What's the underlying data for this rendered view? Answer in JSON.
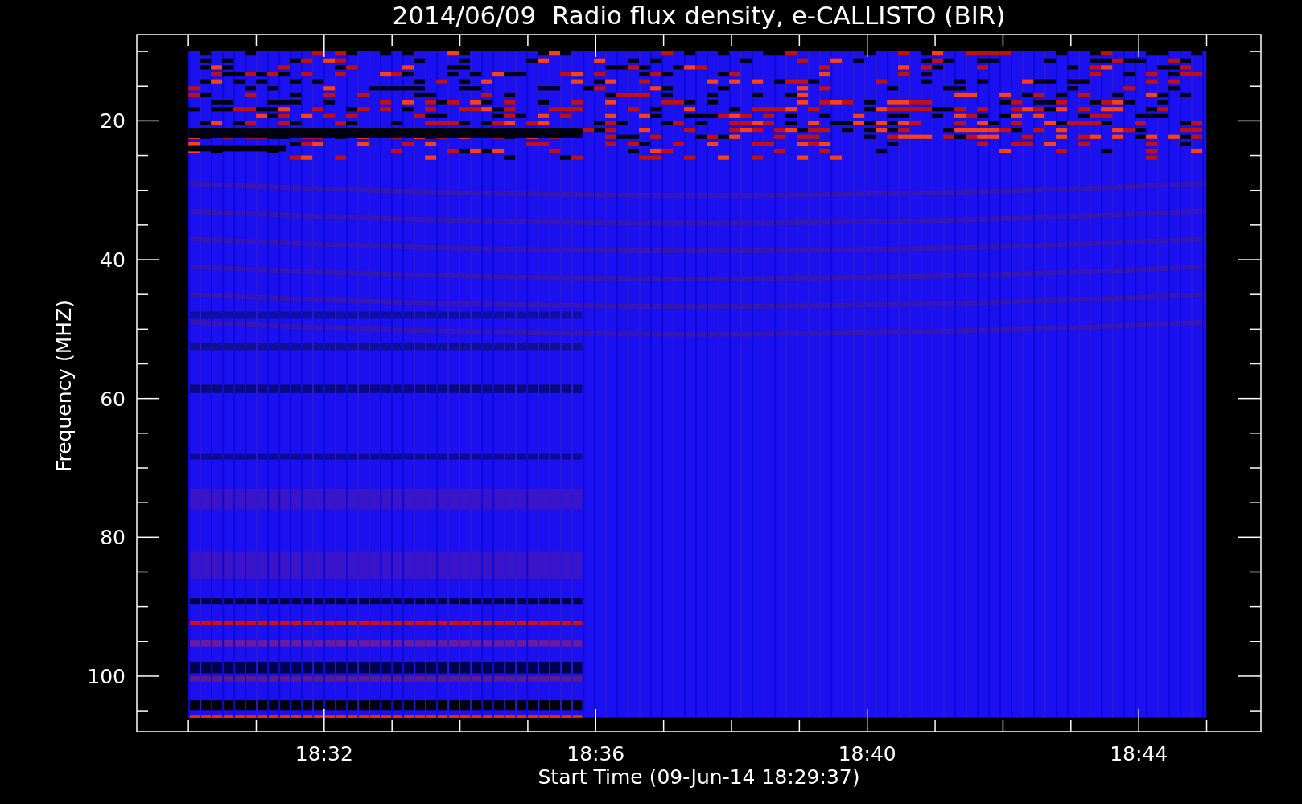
{
  "title": "2014/06/09  Radio flux density, e-CALLISTO (BIR)",
  "y_axis": {
    "label": "Frequency (MHZ)",
    "ticks": [
      "20",
      "40",
      "60",
      "80",
      "100"
    ]
  },
  "x_axis": {
    "label": "Start Time (09-Jun-14 18:29:37)",
    "ticks": [
      "18:32",
      "18:36",
      "18:40",
      "18:44"
    ]
  }
}
